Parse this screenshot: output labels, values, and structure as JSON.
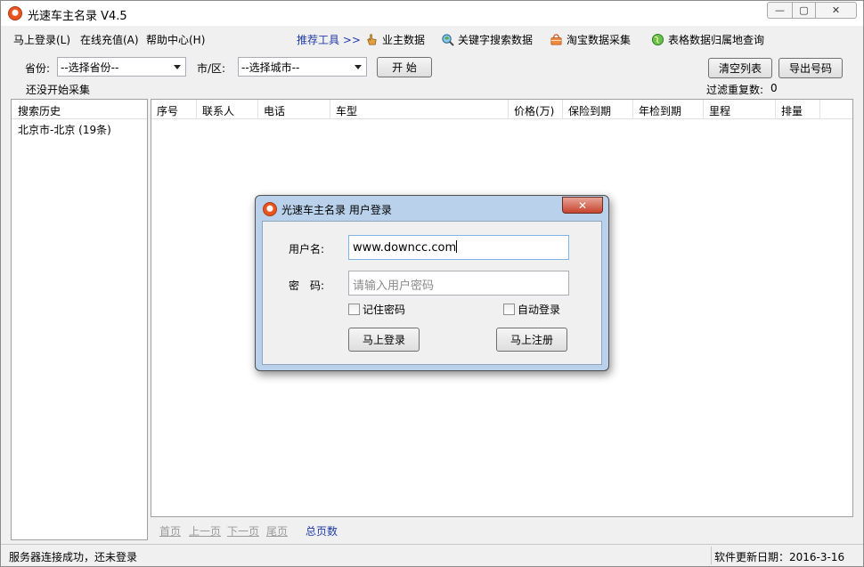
{
  "window": {
    "title": "光速车主名录 V4.5",
    "min_glyph": "—",
    "max_glyph": "▢",
    "close_glyph": "✕"
  },
  "menu": {
    "items": [
      "马上登录(L)",
      "在线充值(A)",
      "帮助中心(H)"
    ],
    "recommend_label": "推荐工具 >>",
    "tools": [
      {
        "label": "业主数据",
        "icon": "hand-pointer-icon",
        "color": "#d08a20"
      },
      {
        "label": "关键字搜索数据",
        "icon": "magnifier-globe-icon",
        "color": "#3a8ac8"
      },
      {
        "label": "淘宝数据采集",
        "icon": "shopping-bag-icon",
        "color": "#e86a1c"
      },
      {
        "label": "表格数据归属地查询",
        "icon": "globe-icon",
        "color": "#3aa83a"
      }
    ]
  },
  "filters": {
    "province_label": "省份:",
    "province_value": "--选择省份--",
    "city_label": "市/区:",
    "city_value": "--选择城市--",
    "start_button": "开 始",
    "clear_button": "清空列表",
    "export_button": "导出号码",
    "status_note": "还没开始采集",
    "dedupe_label": "过滤重复数:",
    "dedupe_count": "0"
  },
  "history": {
    "header": "搜索历史",
    "items": [
      "北京市-北京 (19条)"
    ]
  },
  "grid": {
    "columns": [
      "序号",
      "联系人",
      "电话",
      "车型",
      "价格(万)",
      "保险到期",
      "年检到期",
      "里程",
      "排量"
    ]
  },
  "pager": {
    "first": "首页",
    "prev": "上一页",
    "next": "下一页",
    "last": "尾页",
    "total": "总页数"
  },
  "status": {
    "left": "服务器连接成功，还未登录",
    "right": "软件更新日期：2016-3-16"
  },
  "login_dialog": {
    "title": "光速车主名录 用户登录",
    "close_glyph": "✕",
    "username_label": "用户名:",
    "username_value": "www.downcc.com",
    "password_label": "密　码:",
    "password_placeholder": "请输入用户密码",
    "remember_label": "记住密码",
    "auto_login_label": "自动登录",
    "login_button": "马上登录",
    "register_button": "马上注册"
  }
}
